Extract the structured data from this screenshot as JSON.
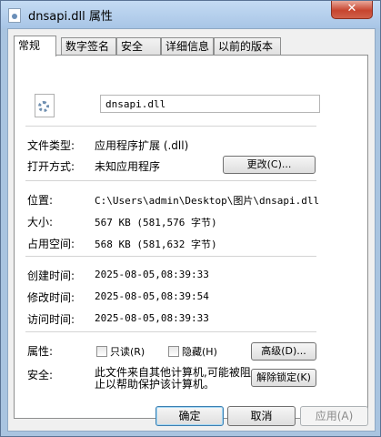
{
  "window": {
    "title": "dnsapi.dll 属性",
    "close_glyph": "✕"
  },
  "tabs": [
    {
      "label": "常规",
      "active": true
    },
    {
      "label": "数字签名",
      "active": false
    },
    {
      "label": "安全",
      "active": false
    },
    {
      "label": "详细信息",
      "active": false
    },
    {
      "label": "以前的版本",
      "active": false
    }
  ],
  "general": {
    "file_name": "dnsapi.dll",
    "file_type_label": "文件类型:",
    "file_type_value": "应用程序扩展 (.dll)",
    "open_with_label": "打开方式:",
    "open_with_value": "未知应用程序",
    "change_button": "更改(C)...",
    "location_label": "位置:",
    "location_value": "C:\\Users\\admin\\Desktop\\图片\\dnsapi.dll",
    "size_label": "大小:",
    "size_value": "567 KB (581,576 字节)",
    "size_on_disk_label": "占用空间:",
    "size_on_disk_value": "568 KB (581,632 字节)",
    "created_label": "创建时间:",
    "created_value": "2025-08-05,08:39:33",
    "modified_label": "修改时间:",
    "modified_value": "2025-08-05,08:39:54",
    "accessed_label": "访问时间:",
    "accessed_value": "2025-08-05,08:39:33",
    "attributes_label": "属性:",
    "readonly_label": "只读(R)",
    "hidden_label": "隐藏(H)",
    "advanced_button": "高级(D)...",
    "security_label": "安全:",
    "security_text": "此文件来自其他计算机,可能被阻止以帮助保护该计算机。",
    "unblock_button": "解除锁定(K)"
  },
  "footer": {
    "ok": "确定",
    "cancel": "取消",
    "apply": "应用(A)"
  }
}
